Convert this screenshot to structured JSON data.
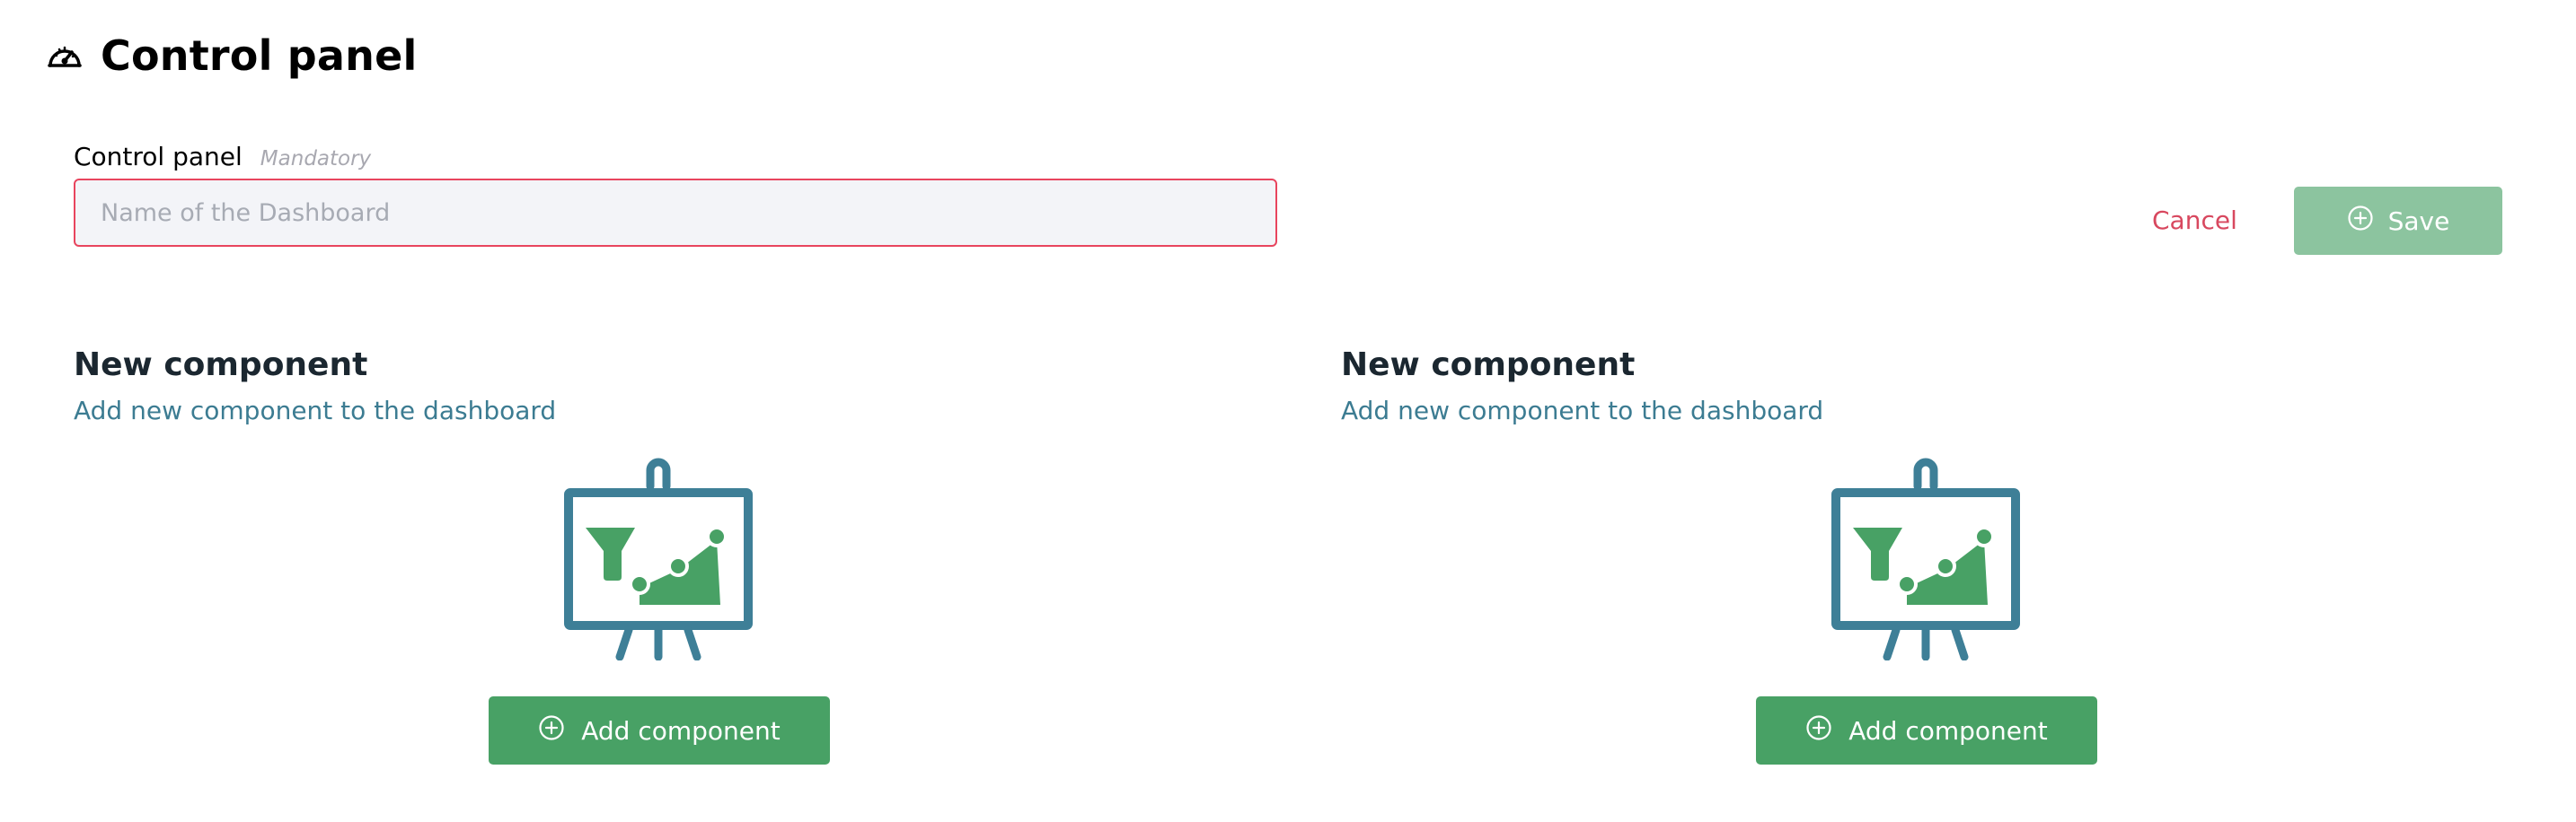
{
  "header": {
    "title": "Control panel",
    "icon": "dashboard-gauge-icon"
  },
  "form": {
    "label": "Control panel",
    "hint": "Mandatory",
    "placeholder": "Name of the Dashboard",
    "value": "",
    "error_border_color": "#e8455e"
  },
  "actions": {
    "cancel_label": "Cancel",
    "save_label": "Save",
    "save_icon": "plus-circle-icon",
    "cancel_color": "#d8485f",
    "save_color": "#8cc49f"
  },
  "components": [
    {
      "title": "New component",
      "subtitle": "Add new component to the dashboard",
      "illustration": "presentation-chart-icon",
      "button_label": "Add component",
      "button_icon": "plus-circle-icon"
    },
    {
      "title": "New component",
      "subtitle": "Add new component to the dashboard",
      "illustration": "presentation-chart-icon",
      "button_label": "Add component",
      "button_icon": "plus-circle-icon"
    }
  ],
  "colors": {
    "accent_green": "#48a165",
    "illustration_blue": "#3e7f97",
    "subtitle_blue": "#3c7c92"
  }
}
